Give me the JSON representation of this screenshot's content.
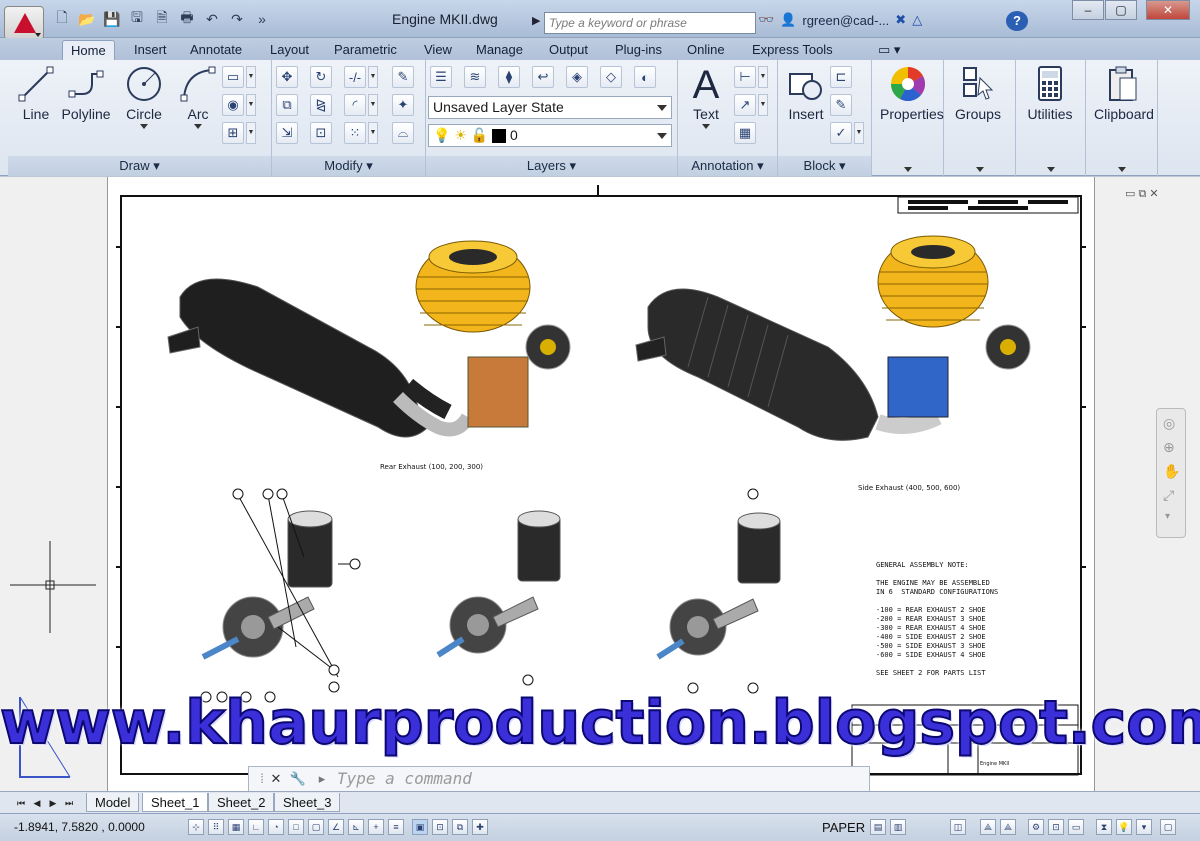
{
  "titlebar": {
    "document_title": "Engine MKII.dwg",
    "search_placeholder": "Type a keyword or phrase",
    "user": "rgreen@cad-...",
    "help": "?",
    "window_controls": [
      "–",
      "▢",
      "✕"
    ]
  },
  "quick_access": [
    "new-icon",
    "open-icon",
    "save-icon",
    "saveas-icon",
    "plot-preview-icon",
    "print-icon",
    "undo-icon",
    "redo-icon",
    "more-icon"
  ],
  "tabs": [
    "Home",
    "Insert",
    "Annotate",
    "Layout",
    "Parametric",
    "View",
    "Manage",
    "Output",
    "Plug-ins",
    "Online",
    "Express Tools"
  ],
  "ribbon": {
    "draw": {
      "title": "Draw",
      "tools": [
        "Line",
        "Polyline",
        "Circle",
        "Arc"
      ]
    },
    "modify": {
      "title": "Modify"
    },
    "layers": {
      "title": "Layers",
      "layer_state": "Unsaved Layer State",
      "current_layer": "0"
    },
    "annotation": {
      "title": "Annotation",
      "text_tool": "Text"
    },
    "block": {
      "title": "Block",
      "insert_tool": "Insert"
    },
    "properties": {
      "label": "Properties"
    },
    "groups": {
      "label": "Groups"
    },
    "utilities": {
      "label": "Utilities"
    },
    "clipboard": {
      "label": "Clipboard"
    }
  },
  "drawing": {
    "caption_rear": "Rear Exhaust (100, 200, 300)",
    "caption_side": "Side Exhaust (400, 500, 600)",
    "general_note": "GENERAL ASSEMBLY NOTE:\n\nTHE ENGINE MAY BE ASSEMBLED\nIN 6  STANDARD CONFIGURATIONS\n\n-100 = REAR EXHAUST 2 SHOE\n-200 = REAR EXHAUST 3 SHOE\n-300 = REAR EXHAUST 4 SHOE\n-400 = SIDE EXHAUST 2 SHOE\n-500 = SIDE EXHAUST 3 SHOE\n-600 = SIDE EXHAUST 4 SHOE\n\nSEE SHEET 2 FOR PARTS LIST",
    "title_block_name": "Engine MKII"
  },
  "watermark": "www.khaurproduction.blogspot.com",
  "command_line": {
    "placeholder": "Type a command"
  },
  "layout_tabs": [
    "Model",
    "Sheet_1",
    "Sheet_2",
    "Sheet_3"
  ],
  "active_layout": "Sheet_1",
  "status": {
    "coordinates": "-1.8941, 7.5820 , 0.0000",
    "space": "PAPER"
  },
  "colors": {
    "engine_head": "#f2b51c",
    "exhaust": "#2a2a2a",
    "accent_blue": "#2f66c8",
    "watermark": "#3b2fd9"
  }
}
